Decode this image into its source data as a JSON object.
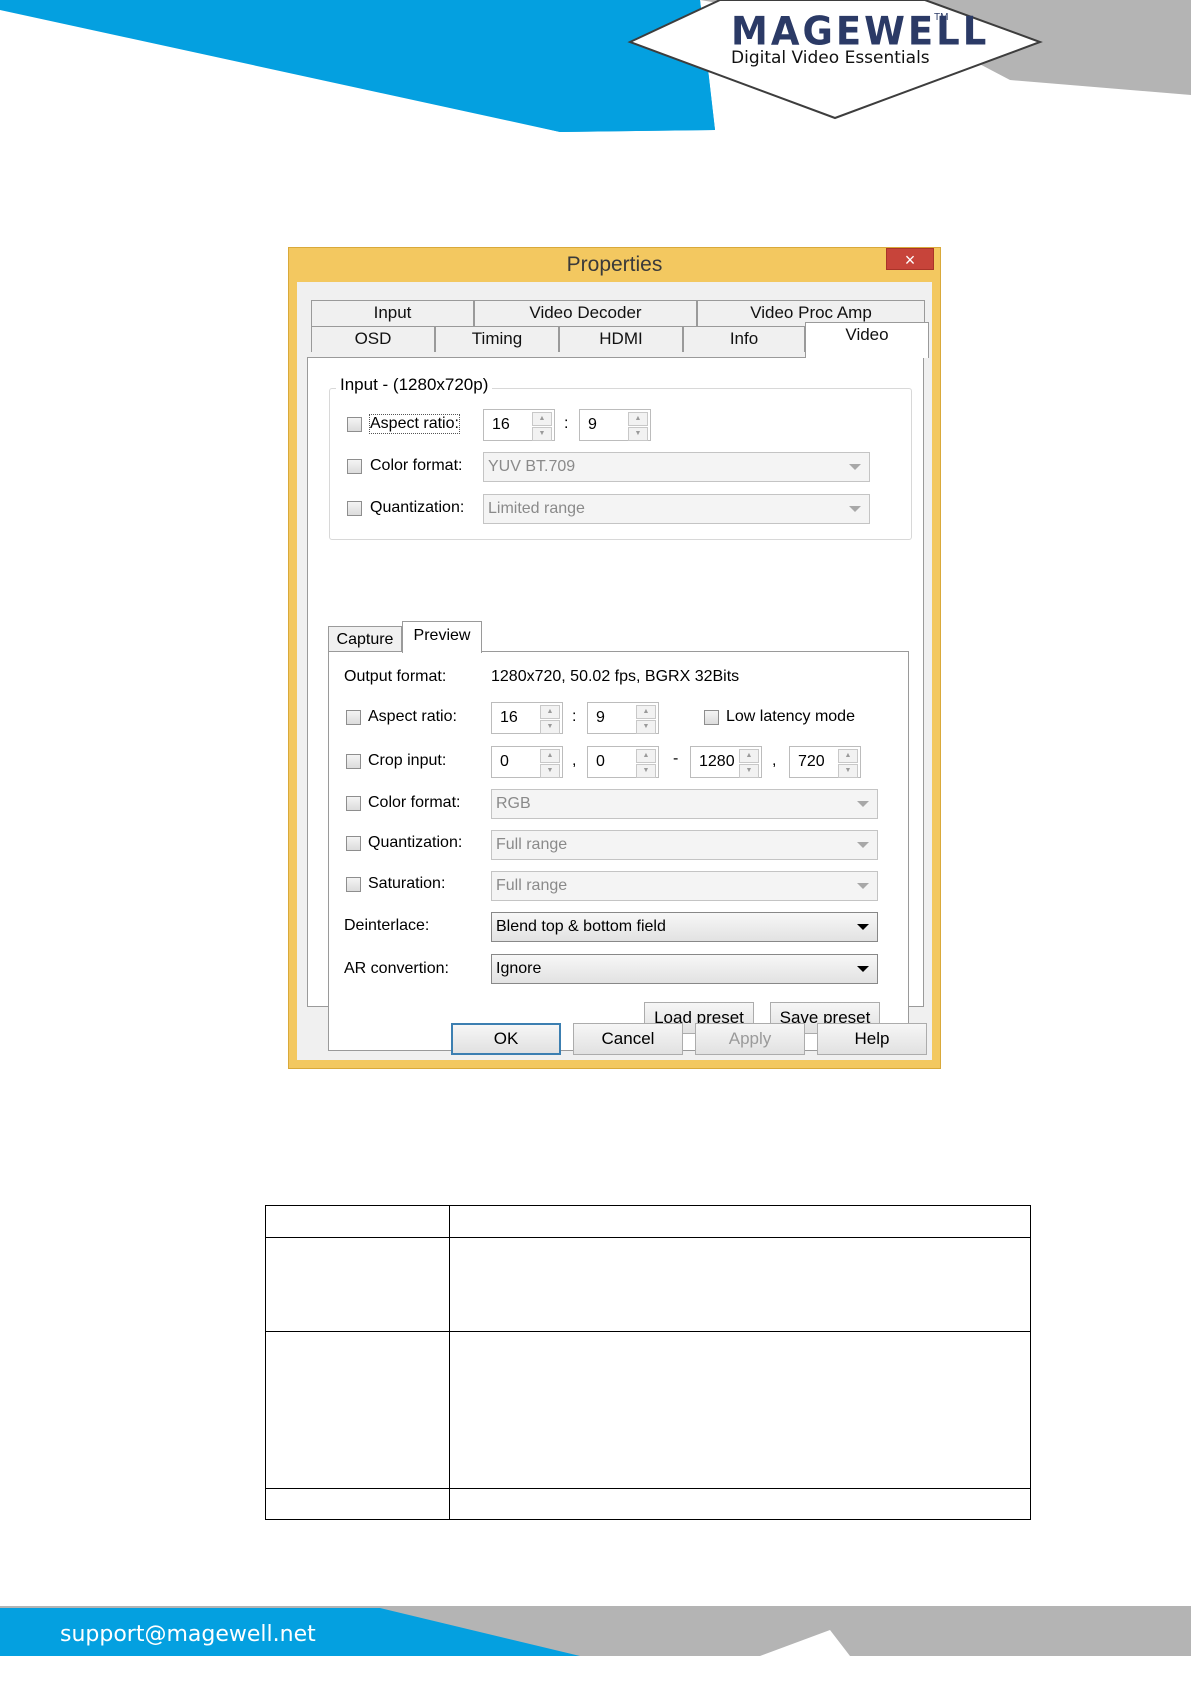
{
  "header": {
    "brand_name": "MAGEWELL",
    "trademark": "TM",
    "tagline": "Digital Video Essentials",
    "colors": {
      "blue": "#04a0e0",
      "gray": "#b4b4b4",
      "navy": "#2b3a66"
    }
  },
  "dialog": {
    "title": "Properties",
    "close_glyph": "×",
    "tabs_row1": [
      "Input",
      "Video Decoder",
      "Video Proc Amp"
    ],
    "tabs_row2": [
      "OSD",
      "Timing",
      "HDMI",
      "Info",
      "Video"
    ],
    "active_tab": "Video",
    "input_group": {
      "title": "Input - (1280x720p)",
      "aspect_label": "Aspect ratio:",
      "aspect_w": "16",
      "aspect_h": "9",
      "colon": ":",
      "color_format_label": "Color format:",
      "color_format_value": "YUV BT.709",
      "quantization_label": "Quantization:",
      "quantization_value": "Limited range"
    },
    "inner_tabs": [
      "Capture",
      "Preview"
    ],
    "active_inner_tab": "Preview",
    "preview": {
      "output_format_label": "Output format:",
      "output_format_value": "1280x720, 50.02 fps, BGRX 32Bits",
      "aspect_label": "Aspect ratio:",
      "aspect_w": "16",
      "aspect_h": "9",
      "colon": ":",
      "low_latency_label": "Low latency mode",
      "crop_label": "Crop input:",
      "crop_x": "0",
      "crop_y": "0",
      "crop_w": "1280",
      "crop_h": "720",
      "comma": ",",
      "dash": "-",
      "color_format_label": "Color format:",
      "color_format_value": "RGB",
      "quantization_label": "Quantization:",
      "quantization_value": "Full range",
      "saturation_label": "Saturation:",
      "saturation_value": "Full range",
      "deinterlace_label": "Deinterlace:",
      "deinterlace_value": "Blend top & bottom field",
      "ar_label": "AR convertion:",
      "ar_value": "Ignore",
      "load_preset": "Load preset",
      "save_preset": "Save preset"
    },
    "buttons": {
      "ok": "OK",
      "cancel": "Cancel",
      "apply": "Apply",
      "help": "Help"
    },
    "colors": {
      "frame": "#f3c860",
      "close": "#c7443a"
    }
  },
  "footer": {
    "email": "support@magewell.net",
    "colors": {
      "blue": "#04a0e0",
      "gray": "#b4b4b4"
    }
  }
}
